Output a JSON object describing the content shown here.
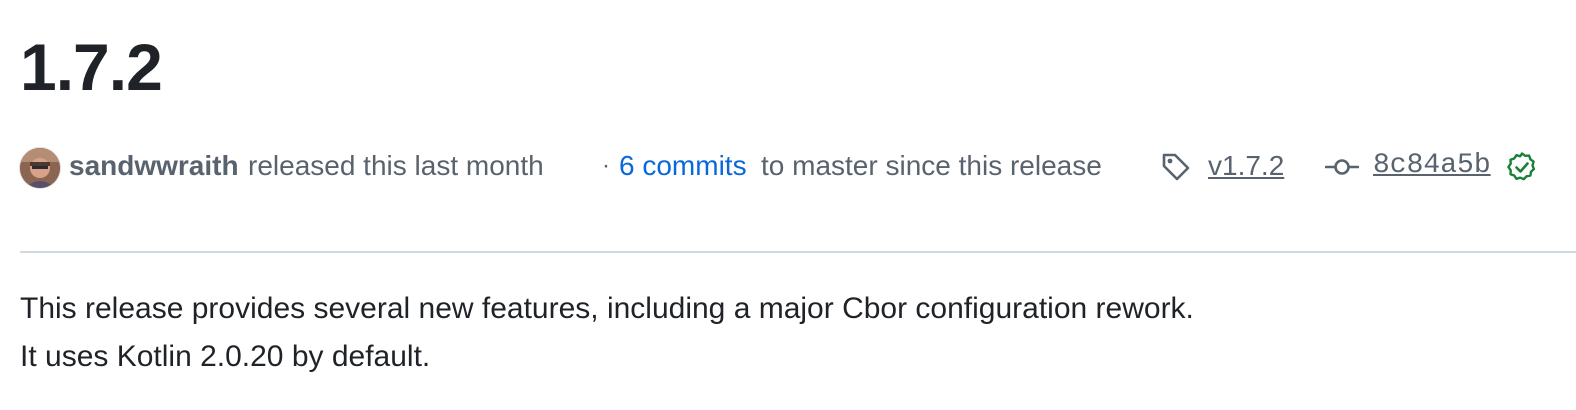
{
  "release": {
    "title": "1.7.2",
    "author": "sandwwraith",
    "released_text": "released this last month",
    "separator": "·",
    "commits_link": "6 commits",
    "commits_suffix": "to master since this release",
    "tag": "v1.7.2",
    "commit_sha": "8c84a5b",
    "verified_status": "verified",
    "body_lines": [
      "This release provides several new features, including a major Cbor configuration rework.",
      "It uses Kotlin 2.0.20 by default."
    ]
  },
  "icons": {
    "tag": "tag-icon",
    "commit": "git-commit-icon",
    "verified": "verified-check-icon",
    "avatar": "user-avatar"
  },
  "colors": {
    "link": "#0969da",
    "muted_text": "#59636e",
    "primary_text": "#1f2328",
    "verified": "#1a7f37",
    "divider": "#d1d9e0"
  }
}
